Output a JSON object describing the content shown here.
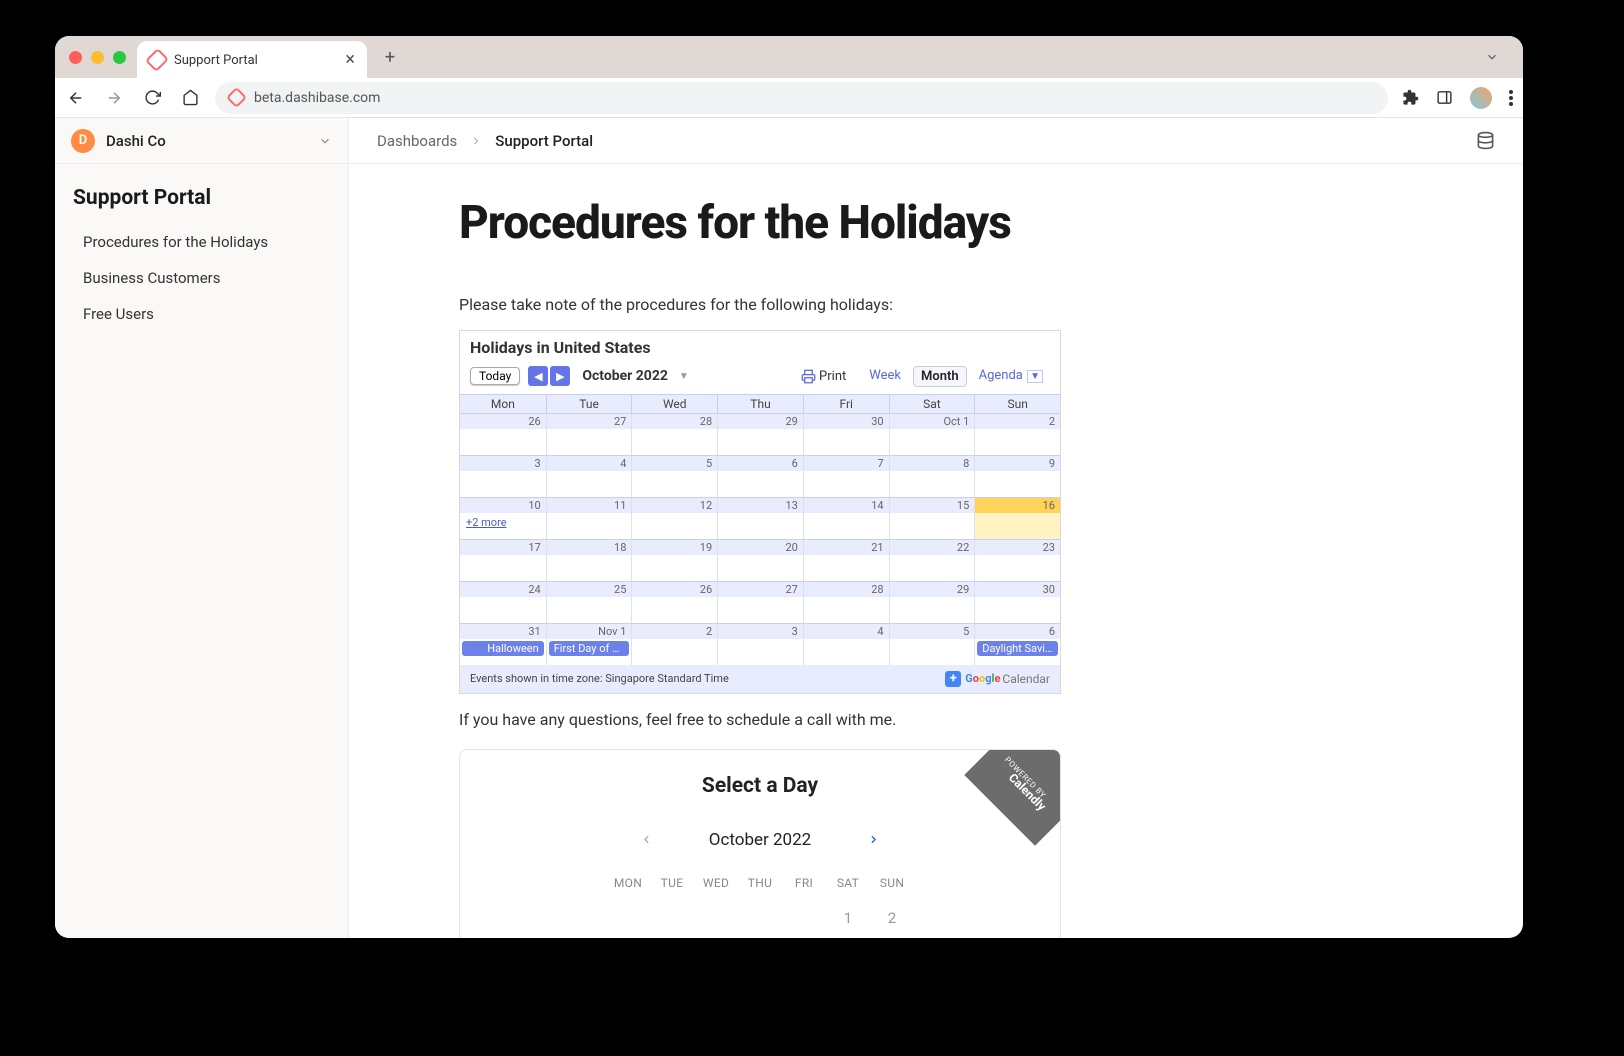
{
  "browser": {
    "tab_title": "Support Portal",
    "url": "beta.dashibase.com"
  },
  "org": {
    "initial": "D",
    "name": "Dashi Co"
  },
  "sidebar": {
    "title": "Support Portal",
    "items": [
      {
        "label": "Procedures for the Holidays"
      },
      {
        "label": "Business Customers"
      },
      {
        "label": "Free Users"
      }
    ]
  },
  "breadcrumbs": [
    {
      "label": "Dashboards",
      "active": false
    },
    {
      "label": "Support Portal",
      "active": true
    }
  ],
  "page": {
    "title": "Procedures for the Holidays",
    "intro": "Please take note of the procedures for the following holidays:",
    "followup": "If you have any questions, feel free to schedule a call with me."
  },
  "gcal": {
    "title": "Holidays in United States",
    "today_label": "Today",
    "month_label": "October 2022",
    "print_label": "Print",
    "views": {
      "week": "Week",
      "month": "Month",
      "agenda": "Agenda"
    },
    "dow": [
      "Mon",
      "Tue",
      "Wed",
      "Thu",
      "Fri",
      "Sat",
      "Sun"
    ],
    "weeks": [
      [
        "26",
        "27",
        "28",
        "29",
        "30",
        "Oct 1",
        "2"
      ],
      [
        "3",
        "4",
        "5",
        "6",
        "7",
        "8",
        "9"
      ],
      [
        "10",
        "11",
        "12",
        "13",
        "14",
        "15",
        "16"
      ],
      [
        "17",
        "18",
        "19",
        "20",
        "21",
        "22",
        "23"
      ],
      [
        "24",
        "25",
        "26",
        "27",
        "28",
        "29",
        "30"
      ],
      [
        "31",
        "Nov 1",
        "2",
        "3",
        "4",
        "5",
        "6"
      ]
    ],
    "more_link": "+2 more",
    "events": {
      "halloween": "Halloween",
      "first_day": "First Day of American Indian Heritage Month",
      "daylight": "Daylight Saving Time Ends"
    },
    "footer_tz": "Events shown in time zone: Singapore Standard Time",
    "calendar_word": "Calendar"
  },
  "calendly": {
    "ribbon_small": "Powered by",
    "ribbon_brand": "Calendly",
    "title": "Select a Day",
    "month": "October 2022",
    "dow": [
      "MON",
      "TUE",
      "WED",
      "THU",
      "FRI",
      "SAT",
      "SUN"
    ],
    "first_row_days": [
      "",
      "",
      "",
      "",
      "",
      "1",
      "2"
    ]
  }
}
